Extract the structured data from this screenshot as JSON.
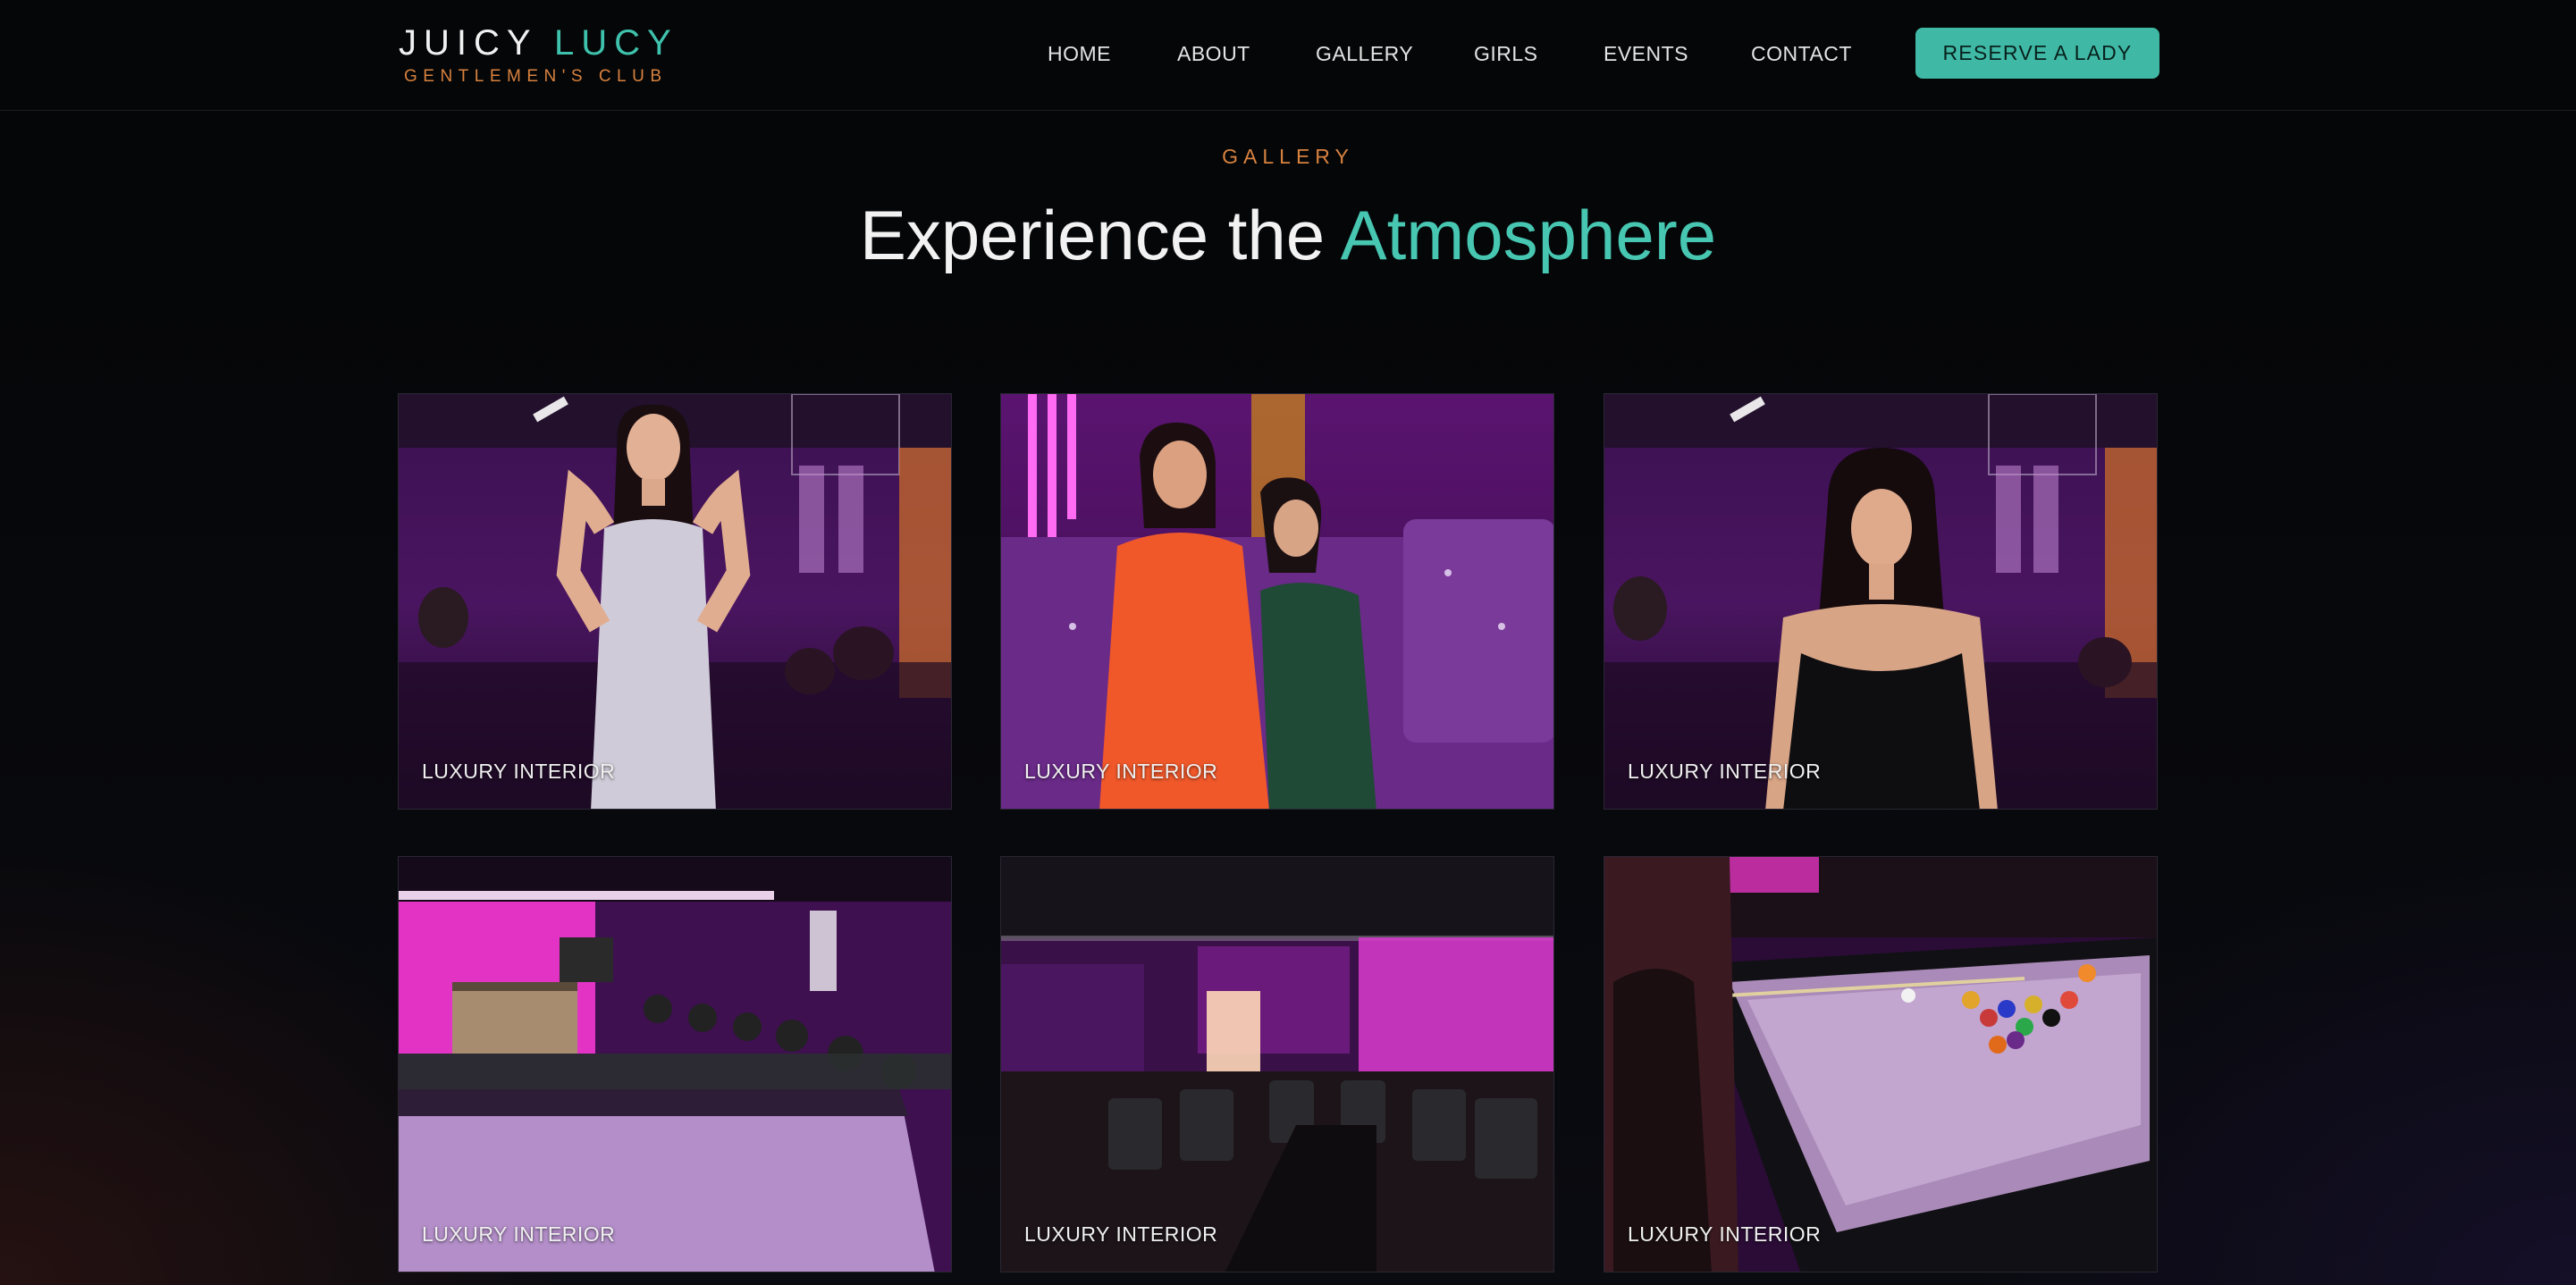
{
  "brand": {
    "name_part1": "JUICY",
    "name_part2": "LUCY",
    "tagline": "GENTLEMEN'S CLUB",
    "accent_color": "#3fc2ad",
    "tagline_color": "#d8823f"
  },
  "nav": {
    "items": [
      {
        "label": "HOME"
      },
      {
        "label": "ABOUT"
      },
      {
        "label": "GALLERY"
      },
      {
        "label": "GIRLS"
      },
      {
        "label": "EVENTS"
      },
      {
        "label": "CONTACT"
      }
    ],
    "cta_label": "RESERVE A LADY",
    "cta_color": "#3fb9a5"
  },
  "section": {
    "eyebrow": "GALLERY",
    "title_part1": "Experience the",
    "title_part2": "Atmosphere"
  },
  "gallery": {
    "tiles": [
      {
        "label": "LUXURY INTERIOR",
        "image": "woman-in-silver-dress-photo"
      },
      {
        "label": "LUXURY INTERIOR",
        "image": "two-women-on-purple-sofa-photo"
      },
      {
        "label": "LUXURY INTERIOR",
        "image": "woman-in-black-dress-photo"
      },
      {
        "label": "LUXURY INTERIOR",
        "image": "bar-with-pool-table-photo"
      },
      {
        "label": "LUXURY INTERIOR",
        "image": "club-lounge-seating-photo"
      },
      {
        "label": "LUXURY INTERIOR",
        "image": "pool-table-game-photo"
      }
    ]
  }
}
